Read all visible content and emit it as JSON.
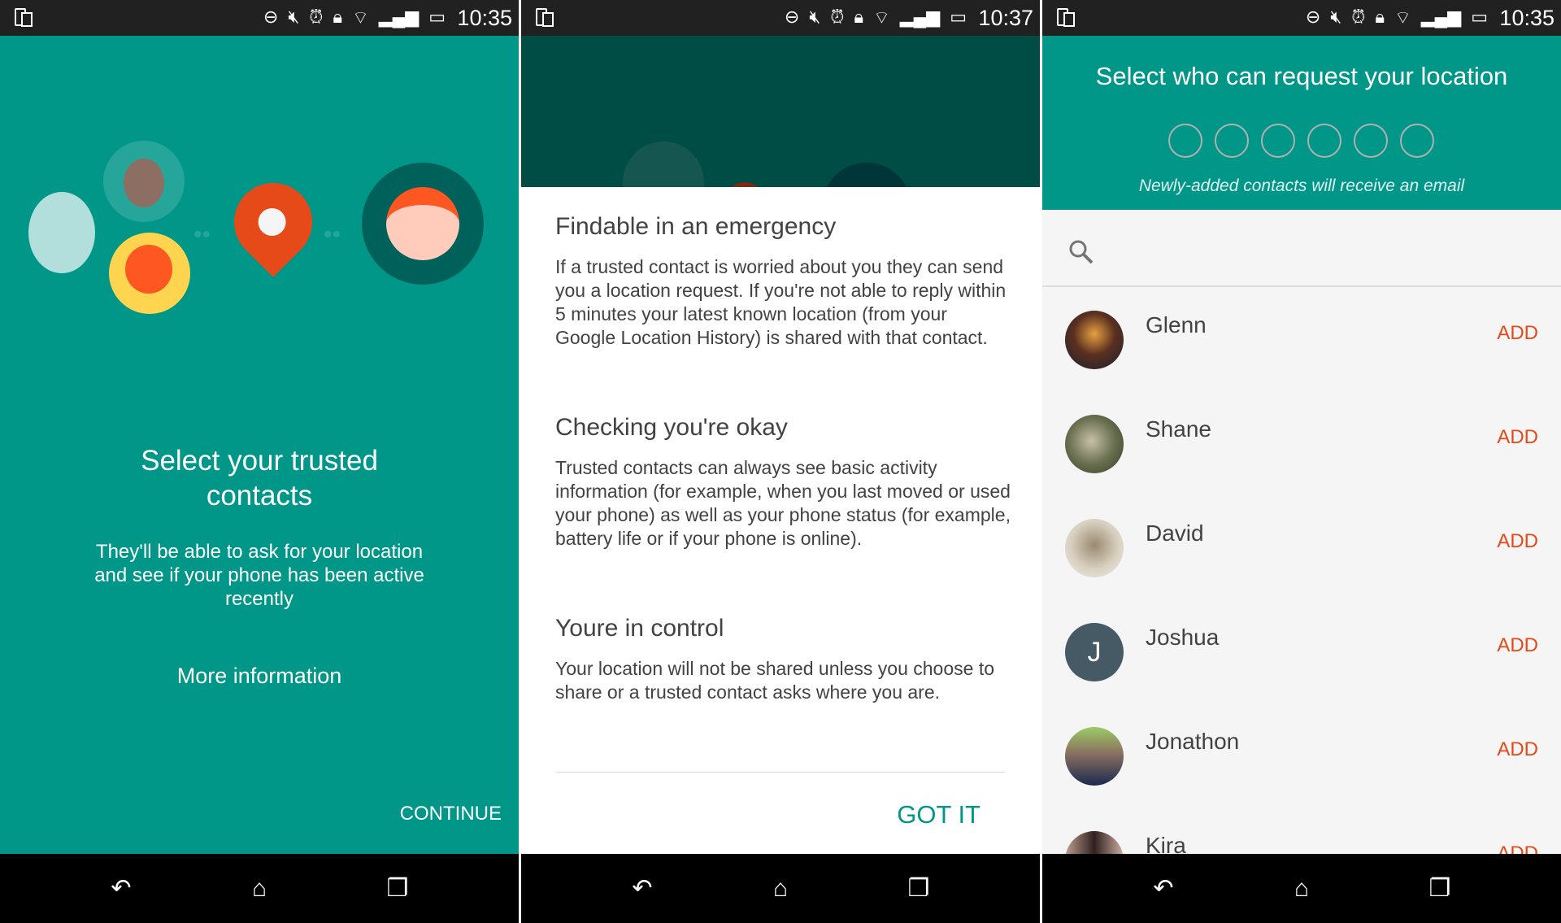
{
  "colors": {
    "teal": "#009688",
    "dark_teal": "#004d45",
    "accent_orange": "#e64a19",
    "list_bg": "#f5f5f5"
  },
  "status_icons": [
    "dnd-icon",
    "mute-icon",
    "alarm-icon",
    "lock-icon",
    "wifi-icon",
    "signal-icon",
    "battery-icon"
  ],
  "nav_icons": [
    "back-icon",
    "home-icon",
    "recents-icon"
  ],
  "screen1": {
    "time": "10:35",
    "title": "Select your trusted contacts",
    "subtitle": "They'll be able to ask for your location and see if your phone has been active recently",
    "more_info": "More information",
    "continue": "CONTINUE"
  },
  "screen2": {
    "time": "10:37",
    "sections": [
      {
        "heading": "Findable in an emergency",
        "body": "If a trusted contact is worried about you they can send you a location request. If you're not able to reply within 5 minutes your latest known location (from your Google Location History) is shared with that contact."
      },
      {
        "heading": "Checking you're okay",
        "body": "Trusted contacts can always see basic activity information (for example, when you last moved or used your phone) as well as your phone status (for example, battery life or if your phone is online)."
      },
      {
        "heading": "Youre in control",
        "body": "Your location will not be shared unless you choose to share or a trusted contact asks where you are."
      }
    ],
    "got_it": "GOT IT"
  },
  "screen3": {
    "time": "10:35",
    "title": "Select who can request your location",
    "slots_filled": 0,
    "slots_total": 6,
    "note": "Newly-added contacts will receive an email",
    "contacts": [
      {
        "name": "Glenn",
        "add": "ADD",
        "initial": ""
      },
      {
        "name": "Shane",
        "add": "ADD",
        "initial": ""
      },
      {
        "name": "David",
        "add": "ADD",
        "initial": ""
      },
      {
        "name": "Joshua",
        "add": "ADD",
        "initial": "J"
      },
      {
        "name": "Jonathon",
        "add": "ADD",
        "initial": ""
      },
      {
        "name": "Kira",
        "add": "ADD",
        "initial": ""
      }
    ]
  }
}
